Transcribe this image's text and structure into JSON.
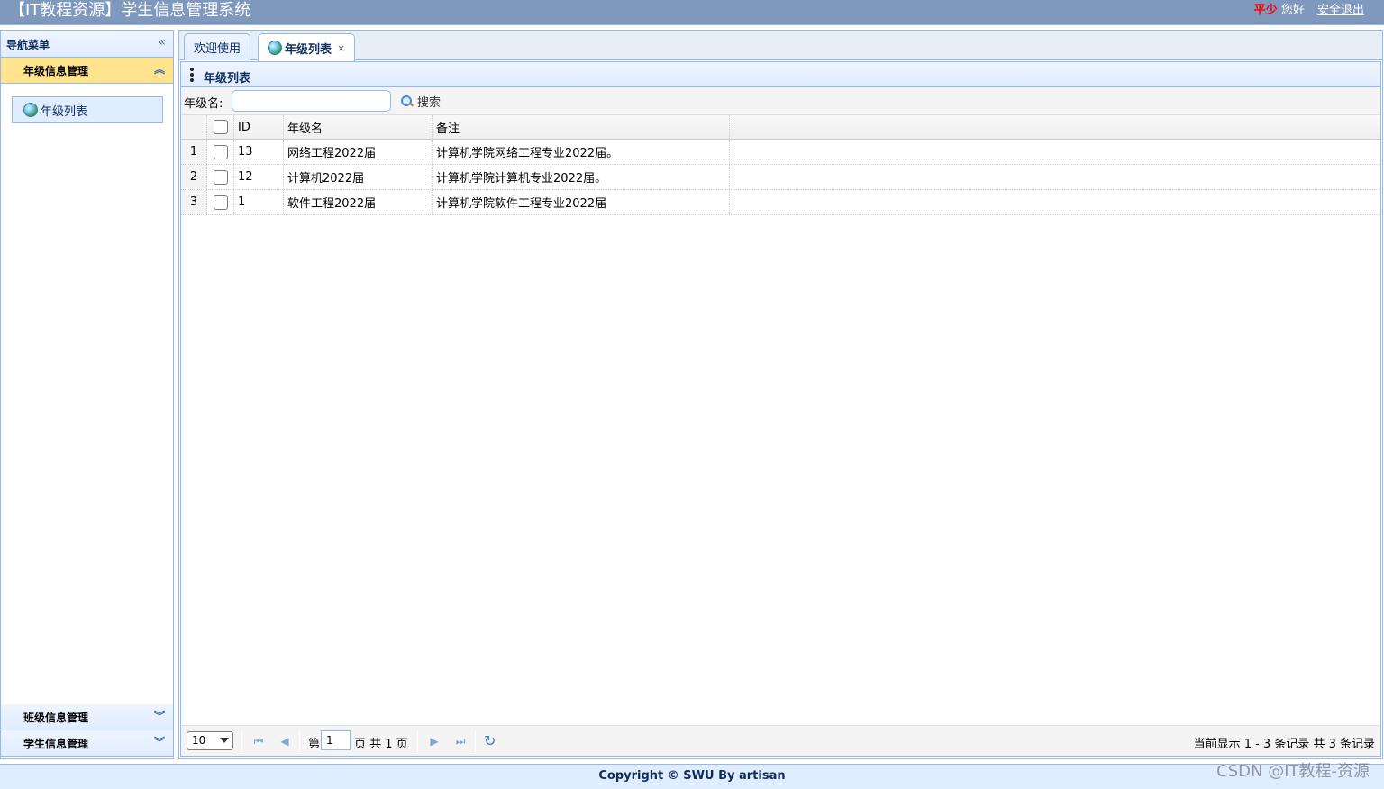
{
  "header": {
    "title": "【IT教程资源】学生信息管理系统",
    "username": "平少",
    "greeting": "您好",
    "logout_label": "安全退出"
  },
  "nav": {
    "title": "导航菜单",
    "sections": [
      {
        "label": "年级信息管理",
        "expanded": true,
        "items": [
          {
            "label": "年级列表",
            "icon": "globe-icon"
          }
        ]
      },
      {
        "label": "班级信息管理",
        "expanded": false
      },
      {
        "label": "学生信息管理",
        "expanded": false
      }
    ]
  },
  "tabs": [
    {
      "label": "欢迎使用",
      "selected": false
    },
    {
      "label": "年级列表",
      "selected": true,
      "closable": true
    }
  ],
  "panel": {
    "title": "年级列表",
    "search": {
      "label": "年级名:",
      "value": "",
      "button_label": "搜索"
    }
  },
  "grid": {
    "columns": [
      "ID",
      "年级名",
      "备注"
    ],
    "rows": [
      {
        "num": "1",
        "id": "13",
        "name": "网络工程2022届",
        "note": "计算机学院网络工程专业2022届。"
      },
      {
        "num": "2",
        "id": "12",
        "name": "计算机2022届",
        "note": "计算机学院计算机专业2022届。"
      },
      {
        "num": "3",
        "id": "1",
        "name": "软件工程2022届",
        "note": "计算机学院软件工程专业2022届"
      }
    ]
  },
  "pager": {
    "page_size": "10",
    "page_prefix": "第",
    "page_value": "1",
    "page_suffix": "页 共 1 页",
    "info": "当前显示 1 - 3 条记录 共 3 条记录"
  },
  "footer": {
    "text": "Copyright © SWU By artisan"
  },
  "watermark": "CSDN @IT教程-资源",
  "colors": {
    "header_bg": "#7f99be",
    "border": "#95b8e7",
    "active_accordion": "#ffe48d",
    "username": "#ff0000"
  }
}
